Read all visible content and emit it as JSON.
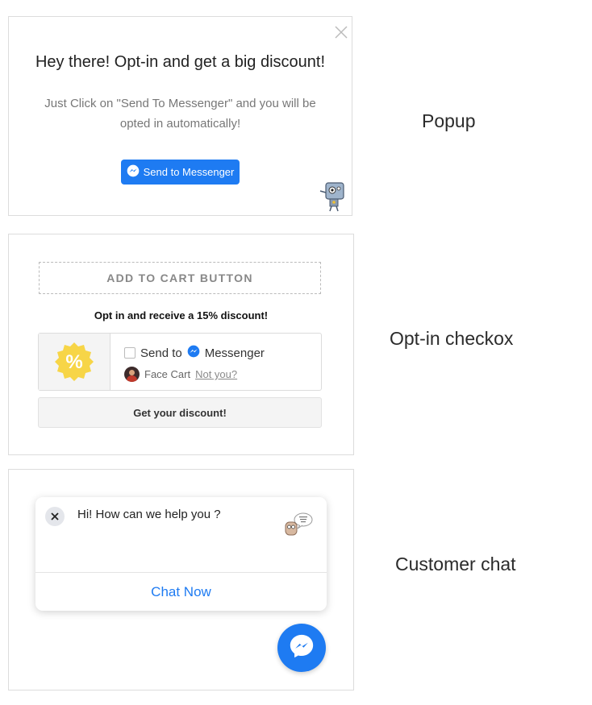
{
  "popup": {
    "title": "Hey there! Opt-in and get a big discount!",
    "subtitle": "Just Click on \"Send To Messenger\" and you will be opted in automatically!",
    "button_label": "Send to Messenger",
    "side_label": "Popup"
  },
  "checkbox": {
    "cart_button_label": "ADD TO CART BUTTON",
    "optin_text": "Opt in and receive a 15% discount!",
    "send_to": "Send to",
    "messenger": "Messenger",
    "user_name": "Face Cart",
    "not_you": "Not you?",
    "discount_button": "Get your discount!",
    "side_label": "Opt-in checkox",
    "badge_symbol": "%"
  },
  "chat": {
    "greeting": "Hi! How can we help you ?",
    "chat_now": "Chat Now",
    "side_label": "Customer chat"
  },
  "colors": {
    "messenger_blue": "#1e7bf2",
    "badge_yellow": "#f7d547"
  },
  "icons": [
    "close-icon",
    "messenger-icon",
    "robot-mascot-icon",
    "discount-badge-icon",
    "user-avatar",
    "chat-mascot-icon"
  ]
}
